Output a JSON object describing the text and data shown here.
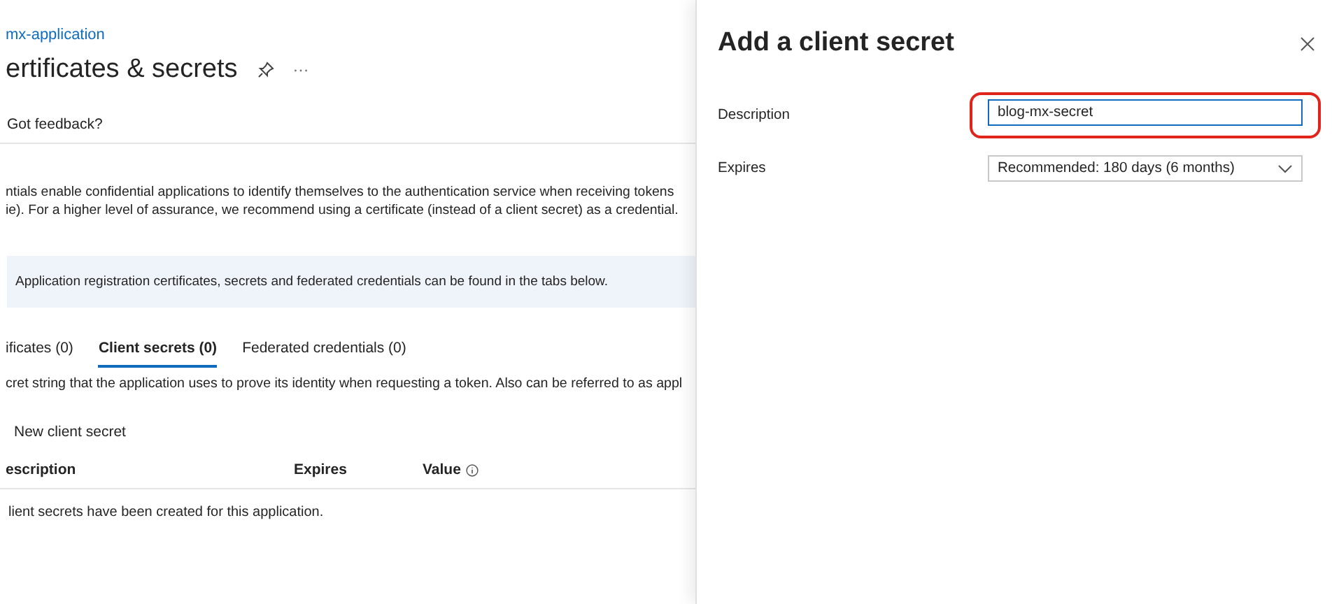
{
  "breadcrumb": "mx-application",
  "page": {
    "title": "ertificates & secrets",
    "feedback": "Got feedback?",
    "intro": [
      "ntials enable confidential applications to identify themselves to the authentication service when receiving tokens",
      "ie). For a higher level of assurance, we recommend using a certificate (instead of a client secret) as a credential."
    ],
    "info": "Application registration certificates, secrets and federated credentials can be found in the tabs below.",
    "tabs": [
      {
        "label": "ificates (0)",
        "selected": false
      },
      {
        "label": "Client secrets (0)",
        "selected": true
      },
      {
        "label": "Federated credentials (0)",
        "selected": false
      }
    ],
    "tab_description": "cret string that the application uses to prove its identity when requesting a token. Also can be referred to as appl",
    "new_button": "New client secret",
    "table": {
      "columns": [
        "escription",
        "Expires",
        "Value"
      ],
      "empty": "lient secrets have been created for this application."
    }
  },
  "drawer": {
    "title": "Add a client secret",
    "fields": [
      {
        "kind": "text",
        "label": "Description",
        "value": "blog-mx-secret",
        "highlighted": true
      },
      {
        "kind": "select",
        "label": "Expires",
        "value": "Recommended: 180 days (6 months)",
        "highlighted": false
      }
    ]
  }
}
